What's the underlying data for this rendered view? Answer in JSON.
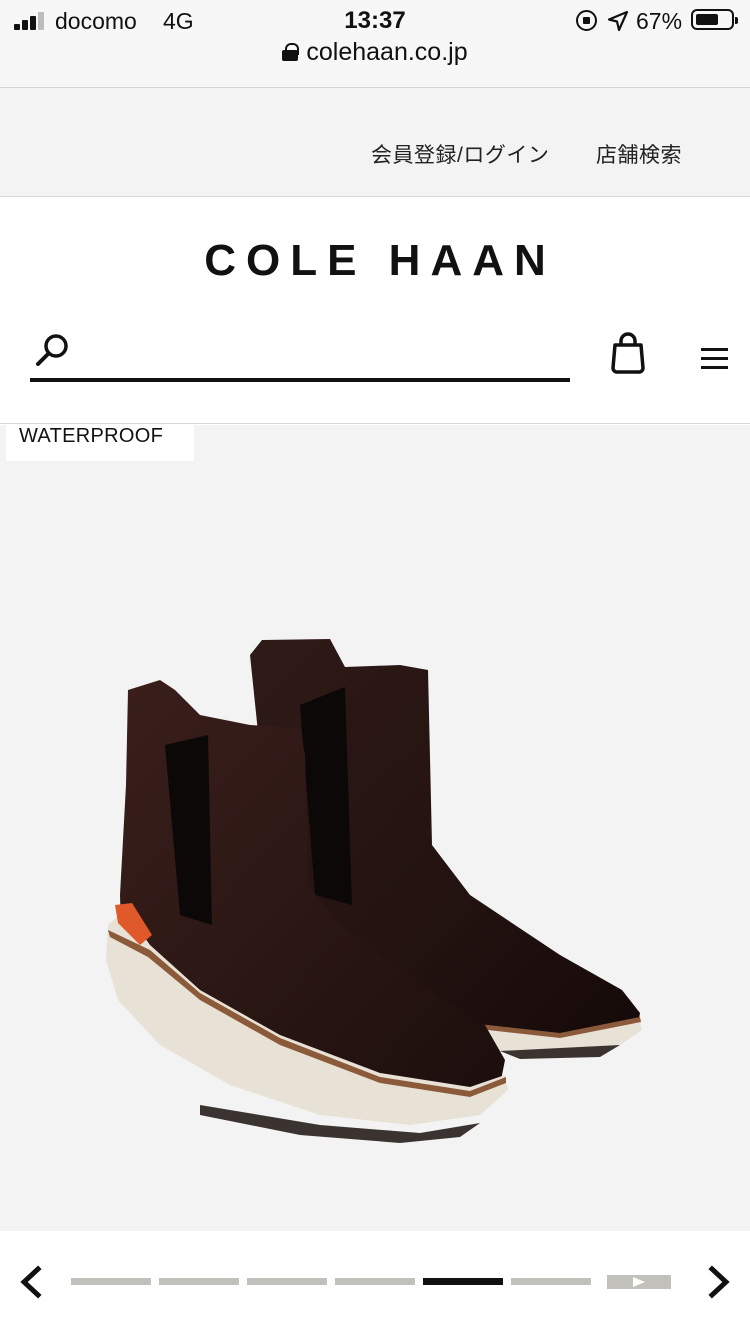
{
  "status_bar": {
    "carrier": "docomo",
    "network": "4G",
    "time": "13:37",
    "battery_percent": "67%",
    "icons": [
      "signal-icon",
      "rotation-lock-icon",
      "location-arrow-icon",
      "battery-icon"
    ]
  },
  "browser": {
    "url": "colehaan.co.jp",
    "icons": [
      "lock-icon"
    ]
  },
  "utility_nav": {
    "login_label": "会員登録/ログイン",
    "store_search_label": "店舗検索"
  },
  "header": {
    "logo_text": "COLE HAAN",
    "search": {
      "value": "",
      "placeholder": ""
    },
    "icons": [
      "search-icon",
      "shopping-bag-icon",
      "menu-icon"
    ]
  },
  "product": {
    "badge": "WATERPROOF",
    "image_subject": "dark brown leather chelsea boots with white sole and orange heel tab"
  },
  "carousel": {
    "slide_count": 7,
    "active_index": 4,
    "has_video_slide": true,
    "icons": [
      "chevron-left-icon",
      "chevron-right-icon",
      "play-icon"
    ]
  },
  "colors": {
    "boot_leather": "#2b1714",
    "sole": "#e8e1d6",
    "sole_trim": "#8b5a3a",
    "heel_tab": "#e0592a",
    "gallery_bg": "#f3f3f3",
    "inactive_dot": "#c2c0bb",
    "active_dot": "#111111"
  }
}
